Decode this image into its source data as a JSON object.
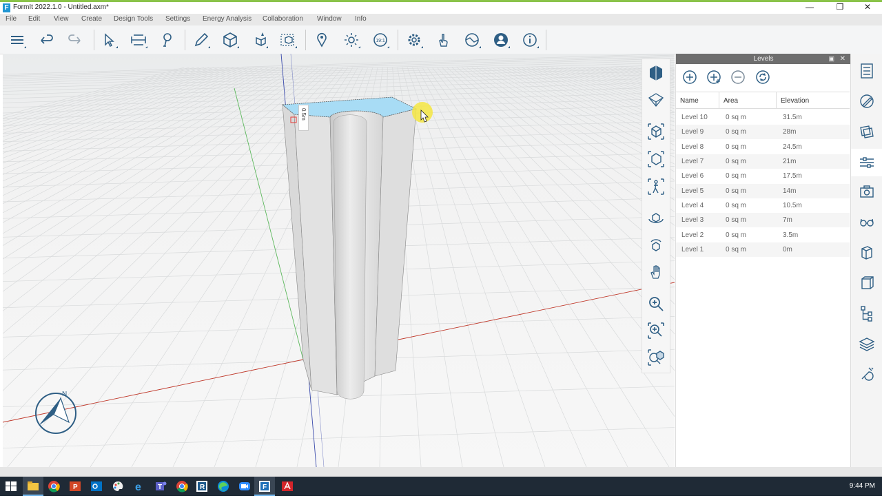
{
  "window": {
    "title": "FormIt 2022.1.0 - Untitled.axm*",
    "logo_letter": "F",
    "controls": {
      "minimize": "—",
      "restore": "❐",
      "close": "✕"
    }
  },
  "menu": [
    "File",
    "Edit",
    "View",
    "Create",
    "Design Tools",
    "Settings",
    "Energy Analysis",
    "Collaboration",
    "Window",
    "Info"
  ],
  "toolbar": {
    "sun_badge": "19:1"
  },
  "viewport": {
    "dimension_label": "0.5m",
    "compass_letter": "N"
  },
  "levels_panel": {
    "title": "Levels",
    "columns": [
      "Name",
      "Area",
      "Elevation"
    ],
    "rows": [
      {
        "name": "Level 10",
        "area": "0 sq m",
        "elevation": "31.5m"
      },
      {
        "name": "Level 9",
        "area": "0 sq m",
        "elevation": "28m"
      },
      {
        "name": "Level 8",
        "area": "0 sq m",
        "elevation": "24.5m"
      },
      {
        "name": "Level 7",
        "area": "0 sq m",
        "elevation": "21m"
      },
      {
        "name": "Level 6",
        "area": "0 sq m",
        "elevation": "17.5m"
      },
      {
        "name": "Level 5",
        "area": "0 sq m",
        "elevation": "14m"
      },
      {
        "name": "Level 4",
        "area": "0 sq m",
        "elevation": "10.5m"
      },
      {
        "name": "Level 3",
        "area": "0 sq m",
        "elevation": "7m"
      },
      {
        "name": "Level 2",
        "area": "0 sq m",
        "elevation": "3.5m"
      },
      {
        "name": "Level 1",
        "area": "0 sq m",
        "elevation": "0m"
      }
    ]
  },
  "taskbar": {
    "clock": "9:44 PM"
  },
  "colors": {
    "accent_green": "#8bc34a",
    "icon_blue": "#2f5f85",
    "selection_blue": "#a8dcf5",
    "axis_red": "#c0392b",
    "axis_green": "#5cb85c"
  }
}
